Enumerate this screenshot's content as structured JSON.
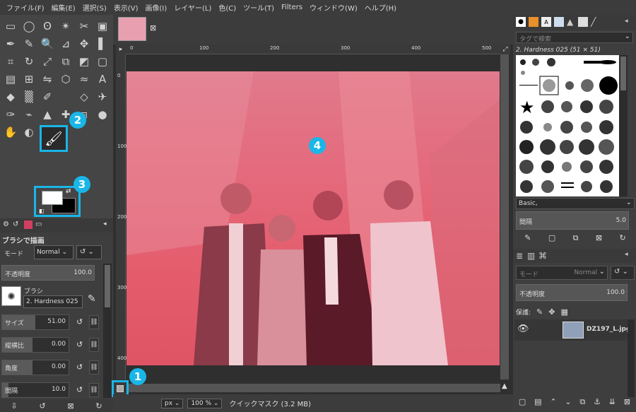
{
  "menu": [
    "ファイル(F)",
    "編集(E)",
    "選択(S)",
    "表示(V)",
    "画像(I)",
    "レイヤー(L)",
    "色(C)",
    "ツール(T)",
    "Filters",
    "ウィンドウ(W)",
    "ヘルプ(H)"
  ],
  "badges": {
    "b1": "1",
    "b2": "2",
    "b3": "3",
    "b4": "4"
  },
  "toolbox": {
    "icons": [
      "rect-select-icon",
      "ellipse-select-icon",
      "free-select-icon",
      "fuzzy-select-icon",
      "scissors-icon",
      "foreground-select-icon",
      "paths-icon",
      "color-picker-icon",
      "zoom-icon",
      "measure-icon",
      "move-icon",
      "align-icon",
      "crop-icon",
      "rotate-icon",
      "scale-icon",
      "shear-icon",
      "perspective-icon",
      "3d-transform-icon",
      "unified-transform-icon",
      "handle-transform-icon",
      "flip-icon",
      "cage-icon",
      "warp-icon",
      "text-icon",
      "bucket-fill-icon",
      "gradient-icon",
      "pencil-icon",
      "paintbrush-icon",
      "eraser-icon",
      "airbrush-icon",
      "ink-icon",
      "mypaint-icon",
      "clone-icon",
      "heal-icon",
      "perspective-clone-icon",
      "blur-icon",
      "smudge-icon",
      "dodge-icon"
    ],
    "glyphs": [
      "▭",
      "◯",
      "ʘ",
      "✴",
      "✂",
      "▣",
      "✒",
      "✎",
      "🔍",
      "⊿",
      "✥",
      "▌",
      "⌗",
      "↻",
      "⤢",
      "⧉",
      "◩",
      "▢",
      "▤",
      "⊞",
      "⇋",
      "⬡",
      "≈",
      "A",
      "◆",
      "▒",
      "✐",
      "✏",
      "◇",
      "✈",
      "✑",
      "⌁",
      "▲",
      "✚",
      "⧈",
      "●",
      "✋",
      "◐"
    ]
  },
  "tool_options": {
    "title": "ブラシで描画",
    "mode_label": "モード",
    "mode_value": "Normal",
    "opacity_label": "不透明度",
    "opacity_value": "100.0",
    "brush_label": "ブラシ",
    "brush_value": "2. Hardness 025",
    "size_label": "サイズ",
    "size_value": "51.00",
    "aspect_label": "縦横比",
    "aspect_value": "0.00",
    "angle_label": "角度",
    "angle_value": "0.00",
    "spacing_label": "間隔",
    "spacing_value": "10.0"
  },
  "ruler": {
    "h": [
      "0",
      "100",
      "200",
      "300",
      "400",
      "500"
    ],
    "v": [
      "0",
      "100",
      "200",
      "300",
      "400"
    ]
  },
  "status": {
    "unit": "px",
    "zoom": "100 %",
    "message": "クイックマスク (3.2 MB)"
  },
  "brushes": {
    "search_placeholder": "タグで検索",
    "current": "2. Hardness 025 (51 × 51)",
    "preset": "Basic,",
    "spacing_label": "間隔",
    "spacing_value": "5.0"
  },
  "layers": {
    "mode_label": "モード",
    "mode_value": "Normal",
    "opacity_label": "不透明度",
    "opacity_value": "100.0",
    "lock_label": "保護:",
    "layer_name": "DZ197_L.jpg"
  },
  "colors": {
    "accent": "#19b6e8",
    "mask_tint": "#e4667a"
  }
}
